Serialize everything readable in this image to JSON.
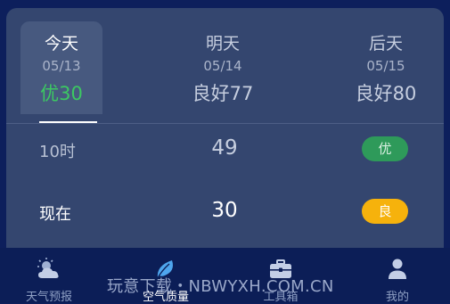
{
  "days": [
    {
      "name": "今天",
      "date": "05/13",
      "aqi": "优30"
    },
    {
      "name": "明天",
      "date": "05/14",
      "aqi": "良好77"
    },
    {
      "name": "后天",
      "date": "05/15",
      "aqi": "良好80"
    }
  ],
  "hourly": [
    {
      "time": "10时",
      "value": "49",
      "level": "优",
      "level_color": "#2e9a5a"
    },
    {
      "time": "现在",
      "value": "30",
      "level": "良",
      "level_color": "#f6b20c"
    }
  ],
  "nav": [
    {
      "label": "天气预报",
      "icon": "cloud-sun-icon"
    },
    {
      "label": "空气质量",
      "icon": "leaf-icon"
    },
    {
      "label": "工具箱",
      "icon": "toolbox-icon"
    },
    {
      "label": "我的",
      "icon": "user-icon"
    }
  ],
  "watermark": "玩意下载・NBWYXH.COM.CN",
  "colors": {
    "background": "#0d1f5c",
    "card": "#34466f",
    "good_green": "#3cc862"
  }
}
